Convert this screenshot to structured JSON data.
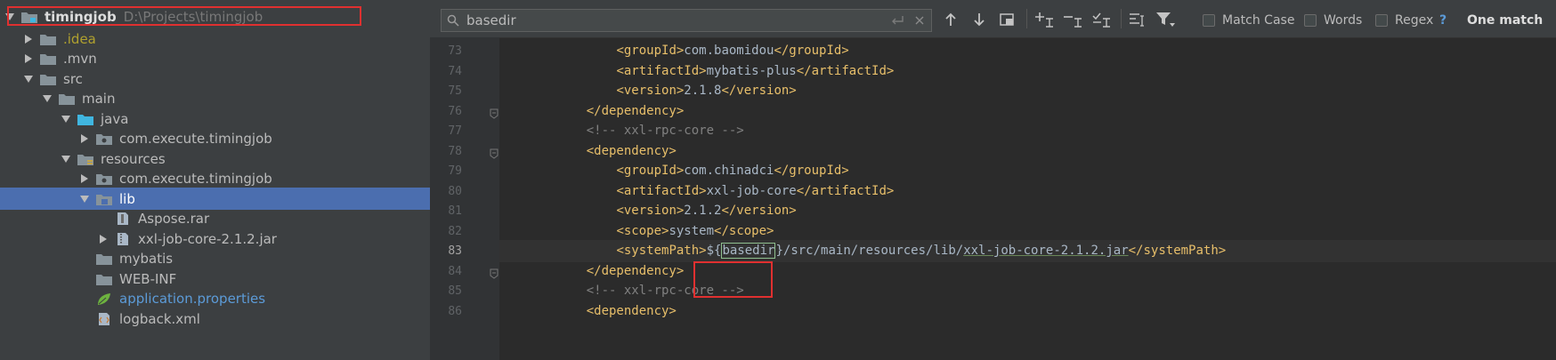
{
  "project_tree": {
    "root": {
      "label": "timingjob",
      "path": "D:\\Projects\\timingjob"
    },
    "items": [
      {
        "label": ".idea",
        "depth": 1,
        "arrow": "right",
        "icon": "folder-icon",
        "style": "idea"
      },
      {
        "label": ".mvn",
        "depth": 1,
        "arrow": "right",
        "icon": "folder-icon"
      },
      {
        "label": "src",
        "depth": 1,
        "arrow": "down",
        "icon": "folder-icon"
      },
      {
        "label": "main",
        "depth": 2,
        "arrow": "down",
        "icon": "folder-icon"
      },
      {
        "label": "java",
        "depth": 3,
        "arrow": "down",
        "icon": "source-folder-icon"
      },
      {
        "label": "com.execute.timingjob",
        "depth": 4,
        "arrow": "right",
        "icon": "package-icon"
      },
      {
        "label": "resources",
        "depth": 3,
        "arrow": "down",
        "icon": "resources-folder-icon"
      },
      {
        "label": "com.execute.timingjob",
        "depth": 4,
        "arrow": "right",
        "icon": "package-icon"
      },
      {
        "label": "lib",
        "depth": 4,
        "arrow": "down",
        "icon": "lib-folder-icon",
        "selected": true
      },
      {
        "label": "Aspose.rar",
        "depth": 5,
        "arrow": "none",
        "icon": "archive-file-icon"
      },
      {
        "label": "xxl-job-core-2.1.2.jar",
        "depth": 5,
        "arrow": "right",
        "icon": "jar-file-icon"
      },
      {
        "label": "mybatis",
        "depth": 4,
        "arrow": "none",
        "icon": "folder-icon"
      },
      {
        "label": "WEB-INF",
        "depth": 4,
        "arrow": "none",
        "icon": "folder-icon"
      },
      {
        "label": "application.properties",
        "depth": 4,
        "arrow": "none",
        "icon": "spring-properties-icon",
        "style": "props"
      },
      {
        "label": "logback.xml",
        "depth": 4,
        "arrow": "none",
        "icon": "xml-file-icon"
      }
    ]
  },
  "find_bar": {
    "query": "basedir",
    "options": {
      "match_case": "Match Case",
      "words": "Words",
      "regex": "Regex",
      "help": "?"
    },
    "result": "One match",
    "colors": {
      "accent": "#4b6eaf",
      "highlight_box": "#e03030"
    }
  },
  "editor": {
    "current_line": 83,
    "lines": [
      {
        "num": "73",
        "parts": [
          [
            "txt",
            "        "
          ],
          [
            "tag",
            "<groupId>"
          ],
          [
            "txt",
            "com.baomidou"
          ],
          [
            "tag",
            "</groupId>"
          ]
        ]
      },
      {
        "num": "74",
        "parts": [
          [
            "txt",
            "        "
          ],
          [
            "tag",
            "<artifactId>"
          ],
          [
            "txt",
            "mybatis-plus"
          ],
          [
            "tag",
            "</artifactId>"
          ]
        ]
      },
      {
        "num": "75",
        "parts": [
          [
            "txt",
            "        "
          ],
          [
            "tag",
            "<version>"
          ],
          [
            "txt",
            "2.1.8"
          ],
          [
            "tag",
            "</version>"
          ]
        ]
      },
      {
        "num": "76",
        "fold": true,
        "parts": [
          [
            "txt",
            "    "
          ],
          [
            "tag",
            "</dependency>"
          ]
        ]
      },
      {
        "num": "77",
        "parts": [
          [
            "txt",
            "    "
          ],
          [
            "cmt",
            "<!-- xxl-rpc-core -->"
          ]
        ]
      },
      {
        "num": "78",
        "fold": true,
        "parts": [
          [
            "txt",
            "    "
          ],
          [
            "tag",
            "<dependency>"
          ]
        ]
      },
      {
        "num": "79",
        "parts": [
          [
            "txt",
            "        "
          ],
          [
            "tag",
            "<groupId>"
          ],
          [
            "txt",
            "com.chinadci"
          ],
          [
            "tag",
            "</groupId>"
          ]
        ]
      },
      {
        "num": "80",
        "parts": [
          [
            "txt",
            "        "
          ],
          [
            "tag",
            "<artifactId>"
          ],
          [
            "txt",
            "xxl-job-core"
          ],
          [
            "tag",
            "</artifactId>"
          ]
        ]
      },
      {
        "num": "81",
        "parts": [
          [
            "txt",
            "        "
          ],
          [
            "tag",
            "<version>"
          ],
          [
            "txt",
            "2.1.2"
          ],
          [
            "tag",
            "</version>"
          ]
        ]
      },
      {
        "num": "82",
        "parts": [
          [
            "txt",
            "        "
          ],
          [
            "tag",
            "<scope>"
          ],
          [
            "txt",
            "system"
          ],
          [
            "tag",
            "</scope>"
          ]
        ]
      },
      {
        "num": "83",
        "parts": [
          [
            "txt",
            "        "
          ],
          [
            "tag",
            "<systemPath>"
          ],
          [
            "txt",
            "${"
          ],
          [
            "hl",
            "basedir"
          ],
          [
            "txt",
            "}/src/main/resources/lib/"
          ],
          [
            "ulink",
            "xxl-job-core-2.1.2.jar"
          ],
          [
            "tag",
            "</systemPath>"
          ]
        ]
      },
      {
        "num": "84",
        "fold": true,
        "parts": [
          [
            "txt",
            "    "
          ],
          [
            "tag",
            "</dependency>"
          ]
        ]
      },
      {
        "num": "85",
        "parts": [
          [
            "txt",
            "    "
          ],
          [
            "cmt",
            "<!-- xxl-rpc-core -->"
          ]
        ]
      },
      {
        "num": "86",
        "parts": [
          [
            "txt",
            "    "
          ],
          [
            "tag",
            "<dependency>"
          ]
        ]
      }
    ]
  }
}
